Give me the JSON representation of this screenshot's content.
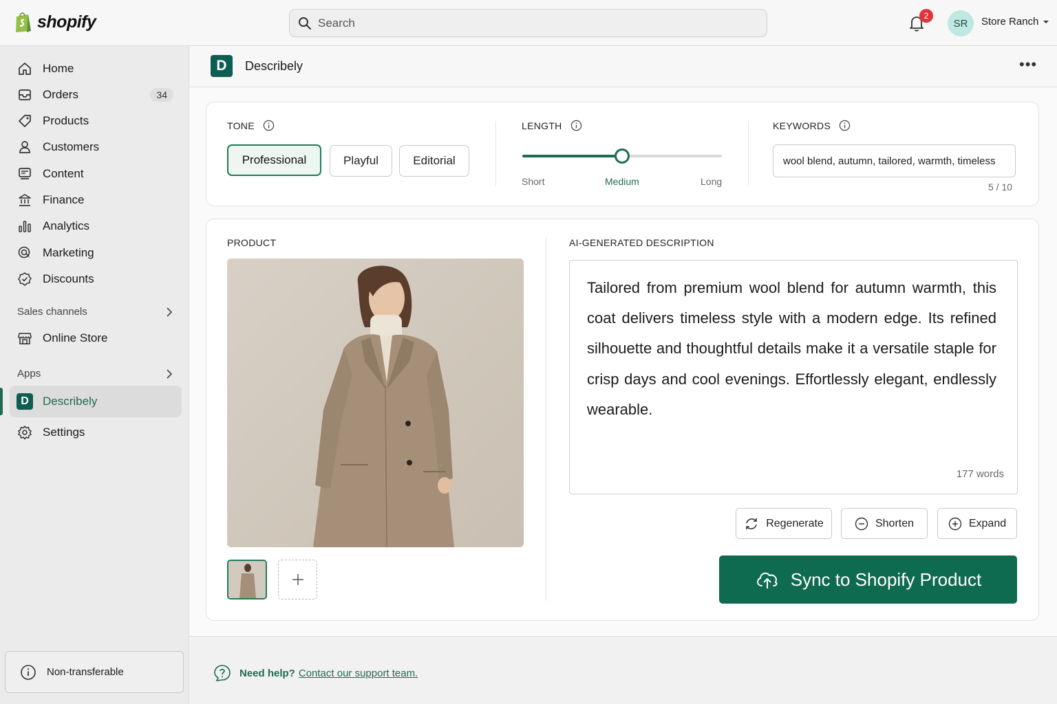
{
  "topbar": {
    "brand": "shopify",
    "search_placeholder": "Search",
    "notification_count": "2",
    "avatar_initials": "SR",
    "store_name": "Store Ranch"
  },
  "sidebar": {
    "items": [
      {
        "label": "Home",
        "icon": "home-icon"
      },
      {
        "label": "Orders",
        "icon": "orders-icon",
        "count": "34"
      },
      {
        "label": "Products",
        "icon": "tag-icon"
      },
      {
        "label": "Customers",
        "icon": "person-icon"
      },
      {
        "label": "Content",
        "icon": "content-icon"
      },
      {
        "label": "Finance",
        "icon": "bank-icon"
      },
      {
        "label": "Analytics",
        "icon": "bar-chart-icon"
      },
      {
        "label": "Marketing",
        "icon": "target-icon"
      },
      {
        "label": "Discounts",
        "icon": "discount-icon"
      }
    ],
    "sales_channels_label": "Sales channels",
    "online_store_label": "Online Store",
    "apps_label": "Apps",
    "app_item_letter": "D",
    "app_item_label": "Describely",
    "settings_label": "Settings",
    "non_transferable_label": "Non-transferable"
  },
  "app_header": {
    "logo_letter": "D",
    "title": "Describely",
    "more_label": "•••"
  },
  "settings": {
    "tone_label": "TONE",
    "tone_options": [
      "Professional",
      "Playful",
      "Editorial"
    ],
    "tone_selected": "Professional",
    "length_label": "LENGTH",
    "length_options": [
      "Short",
      "Medium",
      "Long"
    ],
    "length_selected": "Medium",
    "length_value_fraction": 0.5,
    "keywords_label": "KEYWORDS",
    "keywords_value": "wool blend, autumn, tailored, warmth, timeless",
    "keywords_count": "5 / 10"
  },
  "product": {
    "section_label": "PRODUCT",
    "add_image_label": "+"
  },
  "description": {
    "section_label": "AI-GENERATED DESCRIPTION",
    "text": "Tailored from premium wool blend for autumn warmth, this coat delivers timeless style with a modern edge. Its refined silhouette and thoughtful details make it a versatile staple for crisp days and cool evenings. Effortlessly elegant, endlessly wearable.",
    "word_count": "177 words",
    "regenerate_label": "Regenerate",
    "shorten_label": "Shorten",
    "expand_label": "Expand",
    "sync_label": "Sync to Shopify Product"
  },
  "footer": {
    "help_bold": "Need help?",
    "help_link": "Contact our support team."
  },
  "colors": {
    "accent": "#0f6b50",
    "brand_green": "#95bf47",
    "badge_red": "#e0343a"
  }
}
